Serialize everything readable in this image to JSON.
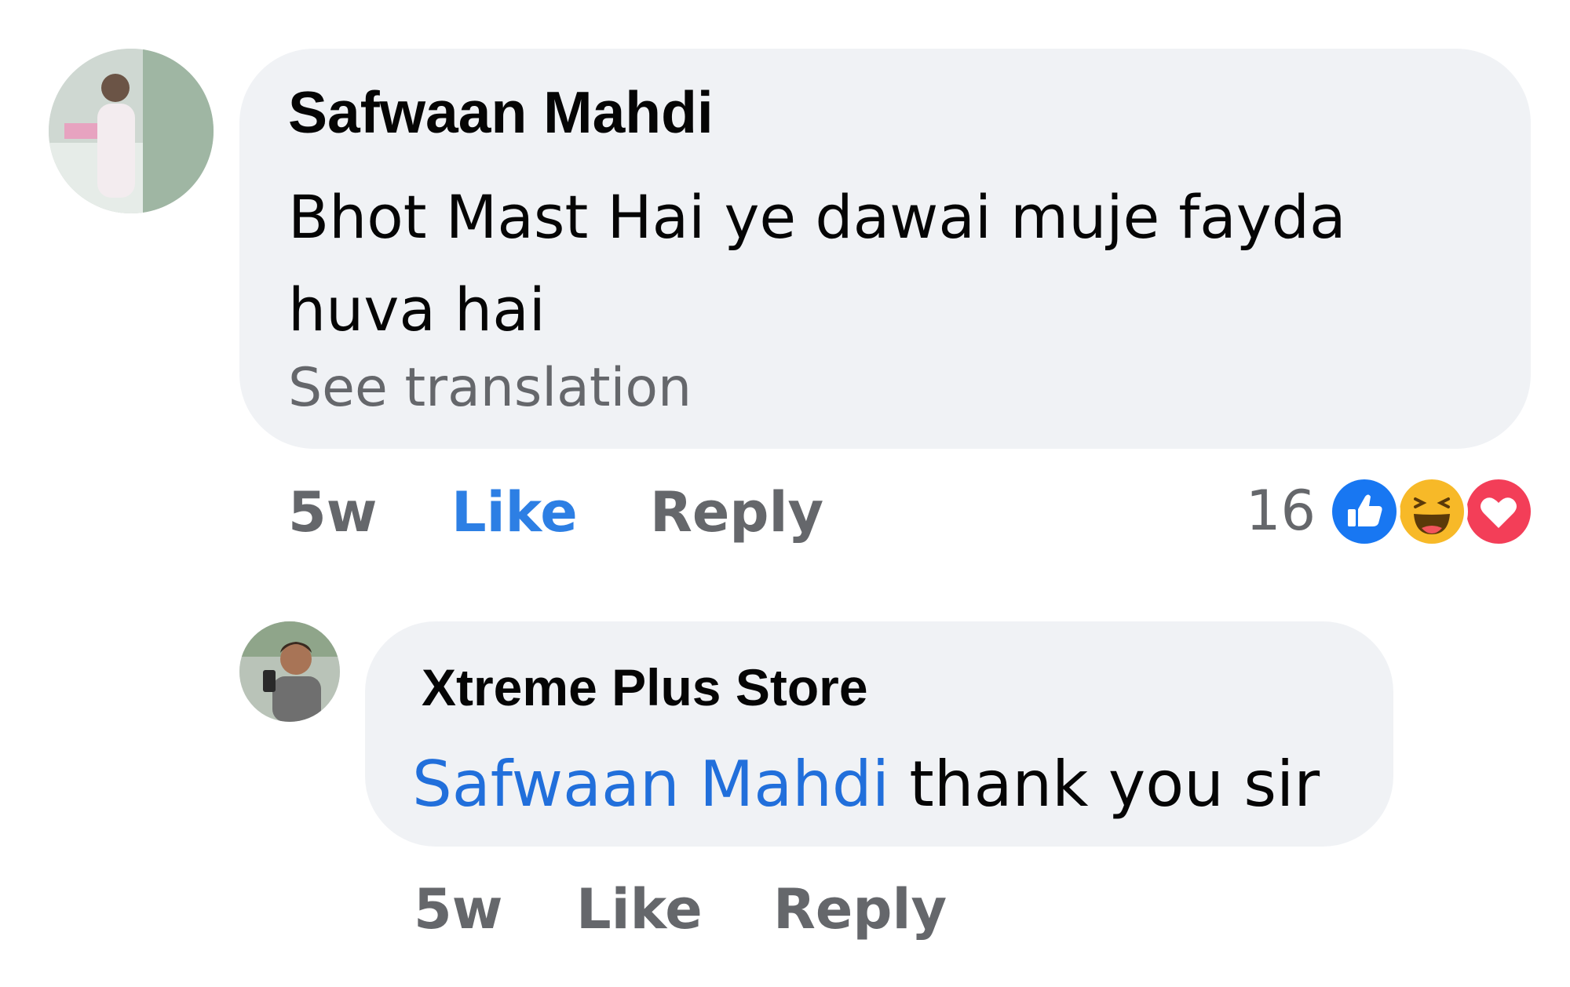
{
  "comment": {
    "author": "Safwaan Mahdi",
    "text": "Bhot Mast Hai ye dawai muje fayda huva hai",
    "see_translation": "See translation",
    "time": "5w",
    "like_label": "Like",
    "reply_label": "Reply",
    "reaction_count": "16",
    "reactions": [
      "like-icon",
      "haha-icon",
      "love-icon"
    ]
  },
  "reply": {
    "author": "Xtreme Plus Store",
    "mention": "Safwaan Mahdi",
    "text": "thank you sir",
    "time": "5w",
    "like_label": "Like",
    "reply_label": "Reply"
  },
  "colors": {
    "bubble": "#f0f2f5",
    "mention": "#216fdb",
    "liked": "#2d7fe4",
    "meta": "#65676b",
    "like_reaction": "#1877f2",
    "haha_reaction": "#f7b928",
    "love_reaction": "#f33e58"
  }
}
